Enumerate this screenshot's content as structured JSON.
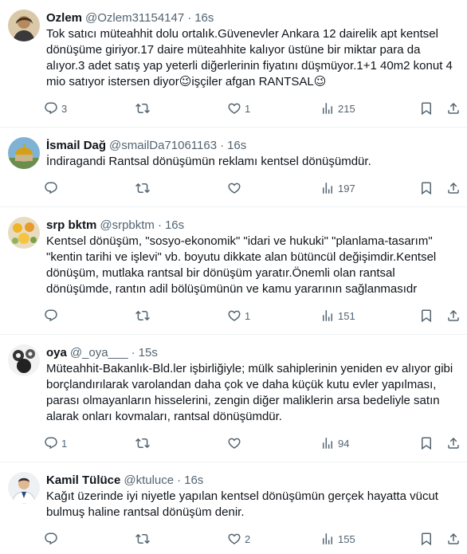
{
  "tweets": [
    {
      "name": "Ozlem",
      "handle": "@Ozlem31154147",
      "dot": "·",
      "time": "16s",
      "text": "Tok satıcı müteahhit dolu ortalık.Güvenevler Ankara 12 dairelik apt kentsel dönüşüme giriyor.17 daire müteahhite kalıyor üstüne bir miktar para da alıyor.3 adet satış yap yeterli diğerlerinin fiyatını düşmüyor.1+1 40m2 konut 4 mio satıyor istersen diyor😉işçiler afgan  RANTSAL😉",
      "replies": "3",
      "retweets": "",
      "likes": "1",
      "views": "215"
    },
    {
      "name": "İsmail Dağ",
      "handle": "@smailDa71061163",
      "dot": "·",
      "time": "16s",
      "text": "İndiragandi Rantsal dönüşümün reklamı kentsel dönüşümdür.",
      "replies": "",
      "retweets": "",
      "likes": "",
      "views": "197"
    },
    {
      "name": "srp bktm",
      "handle": "@srpbktm",
      "dot": "·",
      "time": "16s",
      "text": "Kentsel dönüşüm, \"sosyo-ekonomik\" \"idari ve hukuki\" \"planlama-tasarım\" \"kentin tarihi ve işlevi\" vb. boyutu dikkate alan bütüncül değişimdir.Kentsel dönüşüm, mutlaka rantsal bir dönüşüm yaratır.Önemli olan rantsal dönüşümde, rantın adil bölüşümünün ve kamu yararının sağlanmasıdr",
      "replies": "",
      "retweets": "",
      "likes": "1",
      "views": "151"
    },
    {
      "name": "oya",
      "handle": "@_oya___",
      "dot": "·",
      "time": "15s",
      "text": "Müteahhit-Bakanlık-Bld.ler işbirliğiyle; mülk sahiplerinin yeniden ev alıyor gibi borçlandırılarak varolandan daha çok ve daha küçük kutu evler yapılması, parası olmayanların hisselerini, zengin diğer maliklerin arsa bedeliyle satın alarak onları kovmaları, rantsal dönüşümdür.",
      "replies": "1",
      "retweets": "",
      "likes": "",
      "views": "94"
    },
    {
      "name": "Kamil Tülüce",
      "handle": "@ktuluce",
      "dot": "·",
      "time": "16s",
      "text": "Kağıt üzerinde iyi niyetle yapılan kentsel dönüşümün gerçek hayatta vücut bulmuş haline rantsal dönüşüm denir.",
      "replies": "",
      "retweets": "",
      "likes": "2",
      "views": "155"
    }
  ],
  "icons": [
    "reply-icon",
    "retweet-icon",
    "like-icon",
    "views-icon",
    "bookmark-icon",
    "share-icon"
  ],
  "colors": {
    "text": "#0f1419",
    "secondary": "#536471",
    "divider": "#eff3f4"
  }
}
